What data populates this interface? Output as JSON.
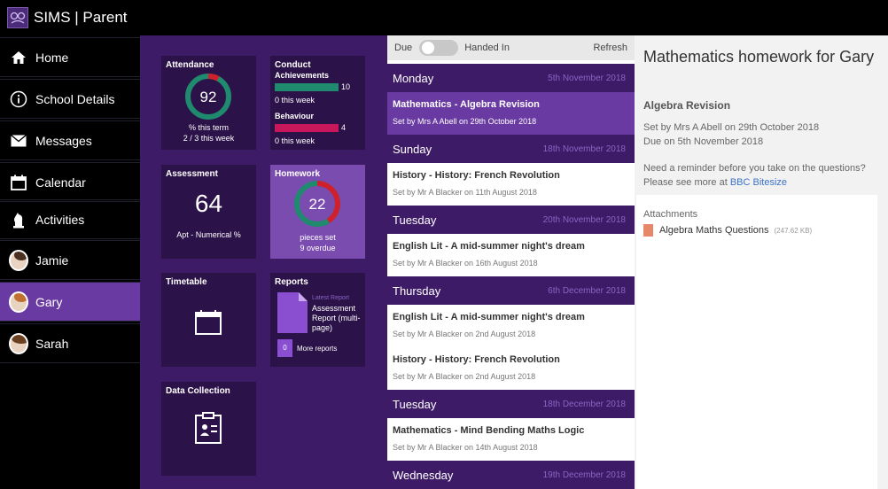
{
  "app": {
    "title": "SIMS | Parent"
  },
  "sidebar": {
    "items": [
      {
        "label": "Home",
        "icon": "home-icon"
      },
      {
        "label": "School Details",
        "icon": "info-icon"
      },
      {
        "label": "Messages",
        "icon": "envelope-icon"
      },
      {
        "label": "Calendar",
        "icon": "calendar-icon"
      },
      {
        "label": "Activities",
        "icon": "chess-knight-icon"
      },
      {
        "label": "Jamie",
        "icon": "avatar"
      },
      {
        "label": "Gary",
        "icon": "avatar",
        "active": true
      },
      {
        "label": "Sarah",
        "icon": "avatar"
      }
    ]
  },
  "dashboard": {
    "attendance": {
      "title": "Attendance",
      "value": "92",
      "percent": 92,
      "line1": "% this term",
      "line2": "2 / 3 this week"
    },
    "conduct": {
      "title": "Conduct",
      "achievements_label": "Achievements",
      "achievements_value": "10",
      "achievements_sub": "0 this week",
      "behaviour_label": "Behaviour",
      "behaviour_value": "4",
      "behaviour_sub": "0 this week"
    },
    "assessment": {
      "title": "Assessment",
      "value": "64",
      "sub": "Apt - Numerical %"
    },
    "homework": {
      "title": "Homework",
      "value": "22",
      "line1": "pieces set",
      "line2": "9 overdue",
      "overdue_fraction": 0.41
    },
    "timetable": {
      "title": "Timetable"
    },
    "reports": {
      "title": "Reports",
      "latest_label": "Latest Report",
      "latest_name": "Assessment Report (multi-page)",
      "more_count": "0",
      "more_label": "More reports"
    },
    "data_collection": {
      "title": "Data Collection"
    }
  },
  "homework_list": {
    "toolbar": {
      "due_label": "Due",
      "handed_in_label": "Handed In",
      "refresh_label": "Refresh"
    },
    "groups": [
      {
        "day": "Monday",
        "date": "5th November 2018",
        "items": [
          {
            "title": "Mathematics - Algebra Revision",
            "meta": "Set by Mrs A Abell on 29th October 2018",
            "selected": true
          }
        ]
      },
      {
        "day": "Sunday",
        "date": "18th November 2018",
        "items": [
          {
            "title": "History - History: French Revolution",
            "meta": "Set by Mr A Blacker on 11th August 2018"
          }
        ]
      },
      {
        "day": "Tuesday",
        "date": "20th November 2018",
        "items": [
          {
            "title": "English Lit - A mid-summer night's dream",
            "meta": "Set by Mr A Blacker on 16th August 2018"
          }
        ]
      },
      {
        "day": "Thursday",
        "date": "6th December 2018",
        "items": [
          {
            "title": "English Lit - A mid-summer night's dream",
            "meta": "Set by Mr A Blacker on 2nd August 2018"
          },
          {
            "title": "History - History: French Revolution",
            "meta": "Set by Mr A Blacker on 2nd August 2018"
          }
        ]
      },
      {
        "day": "Tuesday",
        "date": "18th December 2018",
        "items": [
          {
            "title": "Mathematics - Mind Bending Maths Logic",
            "meta": "Set by Mr A Blacker on 14th August 2018"
          }
        ]
      },
      {
        "day": "Wednesday",
        "date": "19th December 2018",
        "items": []
      }
    ]
  },
  "detail": {
    "title": "Mathematics homework for Gary",
    "subtitle": "Algebra Revision",
    "set_by": "Set by Mrs A Abell on 29th October 2018",
    "due": "Due on 5th November 2018",
    "reminder_line1": "Need a reminder before you take on the questions?",
    "reminder_prefix": "Please see more at ",
    "reminder_link": "BBC Bitesize",
    "attachments_label": "Attachments",
    "attachment_name": "Algebra Maths Questions",
    "attachment_size": "(247.62 KB)"
  },
  "colors": {
    "purple_dark": "#3e1b67",
    "purple_tile": "#2b1248",
    "purple_active": "#6a3aa3",
    "green": "#1f8a6e",
    "red": "#d0202e",
    "pink": "#c8175a"
  }
}
